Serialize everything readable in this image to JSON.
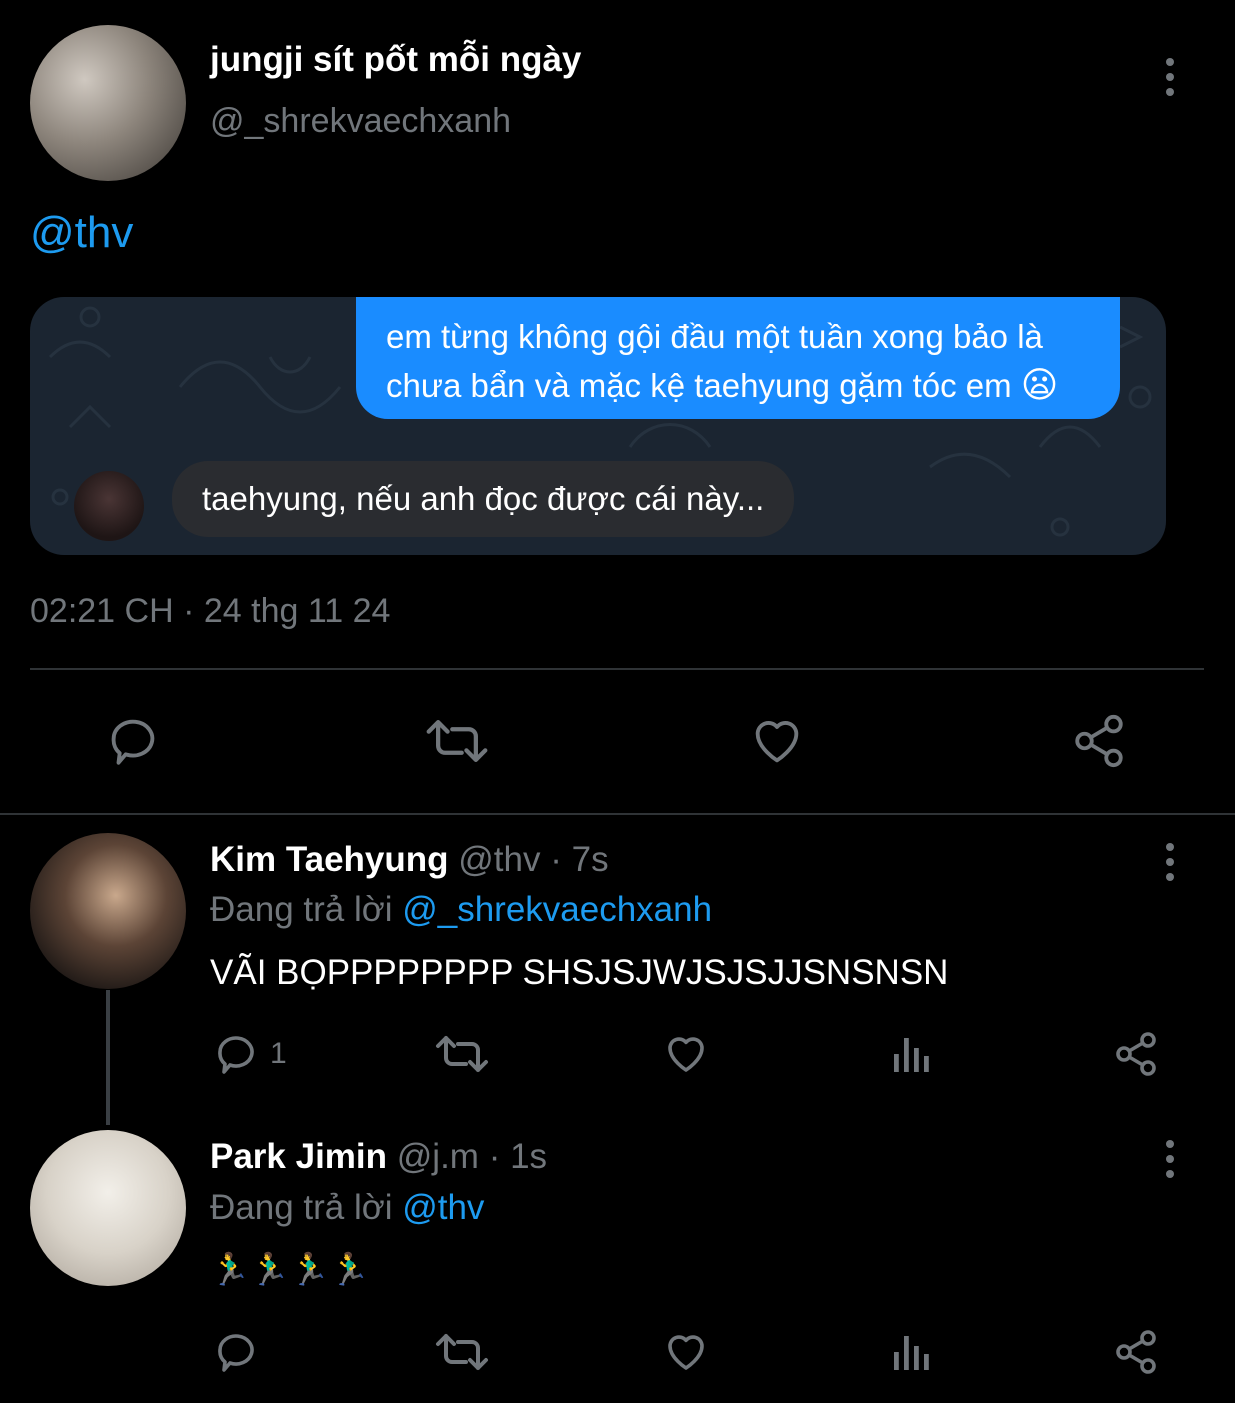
{
  "tweet": {
    "display_name": "jungji sít pốt mỗi ngày",
    "handle": "@_shrekvaechxanh",
    "mention": "@thv",
    "chat": {
      "outgoing": "em từng không gội đầu một tuần xong bảo là chưa bẩn và mặc kệ taehyung gặm tóc em",
      "outgoing_emoji": "😦",
      "incoming": "taehyung, nếu anh đọc được cái này..."
    },
    "timestamp": "02:21 CH · 24 thg 11 24"
  },
  "replies": [
    {
      "display_name": "Kim Taehyung",
      "handle": "@thv",
      "time": "· 7s",
      "replying_prefix": "Đang trả lời",
      "replying_to": "@_shrekvaechxanh",
      "text": "VÃI BỌPPPPPPPP SHSJSJWJSJSJJSNSNSN",
      "reply_count": "1"
    },
    {
      "display_name": "Park Jimin",
      "handle": "@j.m",
      "time": "· 1s",
      "replying_prefix": "Đang trả lời",
      "replying_to": "@thv",
      "text": "🏃‍♂️🏃‍♂️🏃‍♂️🏃‍♂️"
    }
  ],
  "colors": {
    "link": "#1d9bf0",
    "muted": "#71767b",
    "bubble": "#1a8cff"
  }
}
